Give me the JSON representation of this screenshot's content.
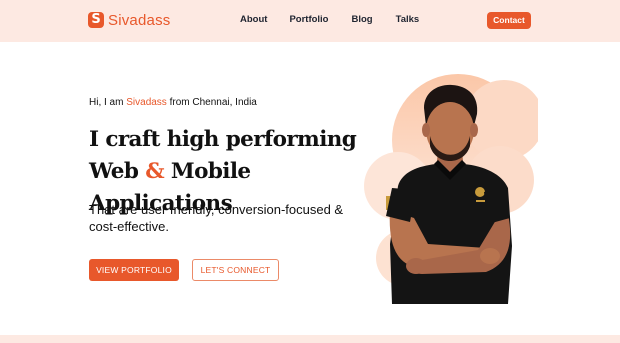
{
  "brand": {
    "name": "Sivadass",
    "logo_glyph": "S",
    "color": "#e8582b"
  },
  "nav": {
    "links": [
      "About",
      "Portfolio",
      "Blog",
      "Talks"
    ],
    "contact_label": "Contact"
  },
  "hero": {
    "greeting_prefix": "Hi, I am ",
    "greeting_name": "Sivadass",
    "greeting_suffix": " from Chennai, India",
    "headline_line1": "I craft high performing",
    "headline_web": "Web",
    "headline_amp": "&",
    "headline_rest": "Mobile Applications",
    "subtitle": "That are user friendly, conversion-focused & cost-effective.",
    "primary_cta": "VIEW PORTFOLIO",
    "secondary_cta": "LET'S CONNECT"
  },
  "colors": {
    "accent": "#e8582b",
    "nav_bg": "#fde9e2",
    "blob": "#fbd9c6",
    "shirt": "#141414"
  },
  "icons": {
    "logo": "s-logo-icon"
  }
}
